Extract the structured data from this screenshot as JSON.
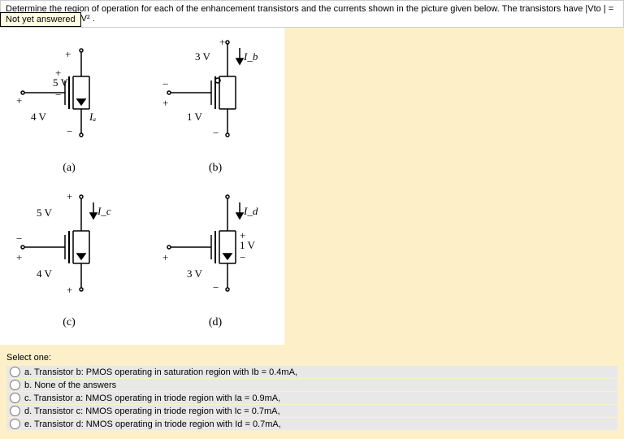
{
  "header": {
    "question_text": "Determine the region of operation for each of the enhancement transistors and the currents shown in the picture given below. The transistors have |Vto | = 1V and K = 0.1mA/V² ."
  },
  "tooltip": {
    "text": "Not yet answered"
  },
  "circuits": {
    "a": {
      "top_sign": "+",
      "gate_top": "+",
      "gate_v": "5 V",
      "gate_bot": "−",
      "src_sign": "+",
      "drain_v": "4 V",
      "current": "Iₐ",
      "bot_sign": "−",
      "label": "(a)"
    },
    "b": {
      "top_sign": "+",
      "top_v": "3 V",
      "current": "I_b",
      "drain_top": "−",
      "drain_bot": "+",
      "drain_v": "1 V",
      "bot_sign": "−",
      "label": "(b)"
    },
    "c": {
      "top_sign": "+",
      "top_v": "5 V",
      "current": "I_c",
      "drain_top": "−",
      "drain_bot": "+",
      "src_v": "4 V",
      "bot_sign": "+",
      "label": "(c)"
    },
    "d": {
      "top_sign": "",
      "current": "I_d",
      "gate_top": "+",
      "gate_v": "1 V",
      "gate_bot": "−",
      "drain_top": "+",
      "drain_bot": "",
      "src_v": "3 V",
      "bot_sign": "−",
      "label": "(d)"
    },
    "gnd_o": "o"
  },
  "answers": {
    "select_label": "Select one:",
    "options": {
      "a": "a. Transistor b: PMOS operating in saturation region with Ib = 0.4mA,",
      "b": "b. None of the answers",
      "c": "c. Transistor a: NMOS operating in triode region with Ia = 0.9mA,",
      "d": "d. Transistor c: NMOS operating in triode region with Ic = 0.7mA,",
      "e": "e. Transistor d: NMOS operating in triode region with Id = 0.7mA,"
    }
  }
}
